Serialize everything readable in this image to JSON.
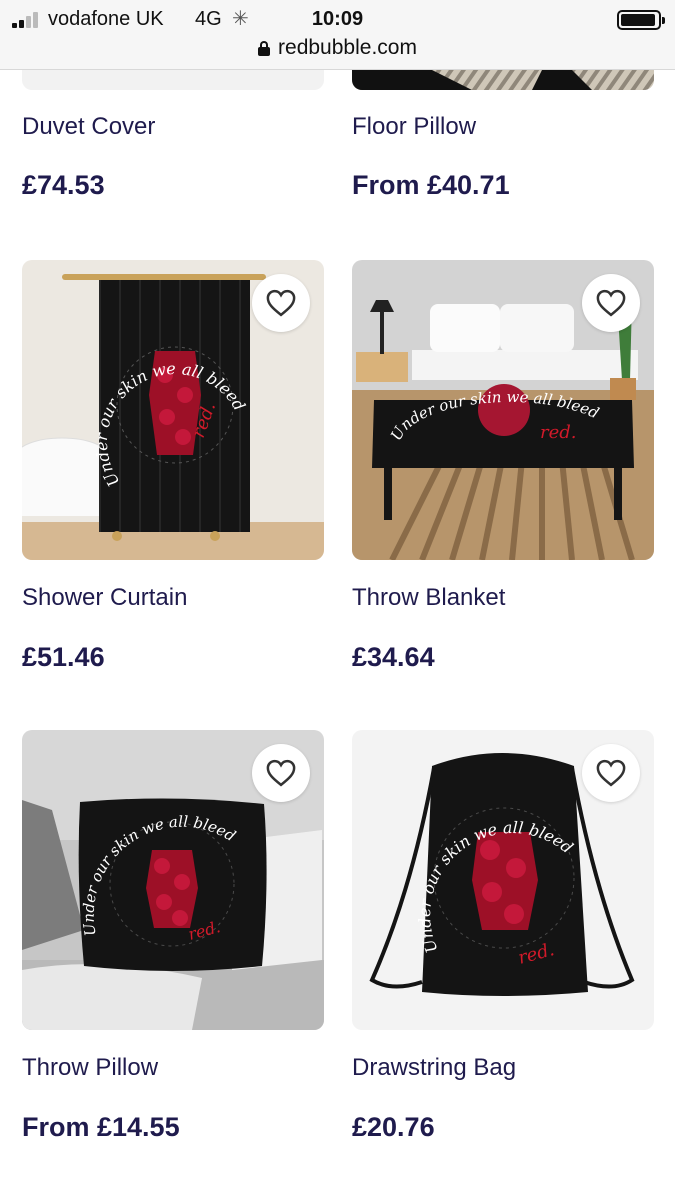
{
  "status_bar": {
    "carrier": "vodafone UK",
    "network": "4G",
    "time": "10:09"
  },
  "url_bar": {
    "domain": "redbubble.com"
  },
  "design_text": {
    "line1": "Under our skin we all bleed",
    "line2": "red."
  },
  "products": [
    {
      "title": "Duvet Cover",
      "price": "£74.53"
    },
    {
      "title": "Floor Pillow",
      "price": "From £40.71"
    },
    {
      "title": "Shower Curtain",
      "price": "£51.46"
    },
    {
      "title": "Throw Blanket",
      "price": "£34.64"
    },
    {
      "title": "Throw Pillow",
      "price": "From £14.55"
    },
    {
      "title": "Drawstring Bag",
      "price": "£20.76"
    }
  ],
  "colors": {
    "text": "#1f1b4d",
    "design_background": "#111111",
    "rose_red": "#b3132d",
    "accent_red": "#d11a2a"
  },
  "icons": {
    "favorite": "heart-outline-icon",
    "secure": "lock-icon"
  }
}
